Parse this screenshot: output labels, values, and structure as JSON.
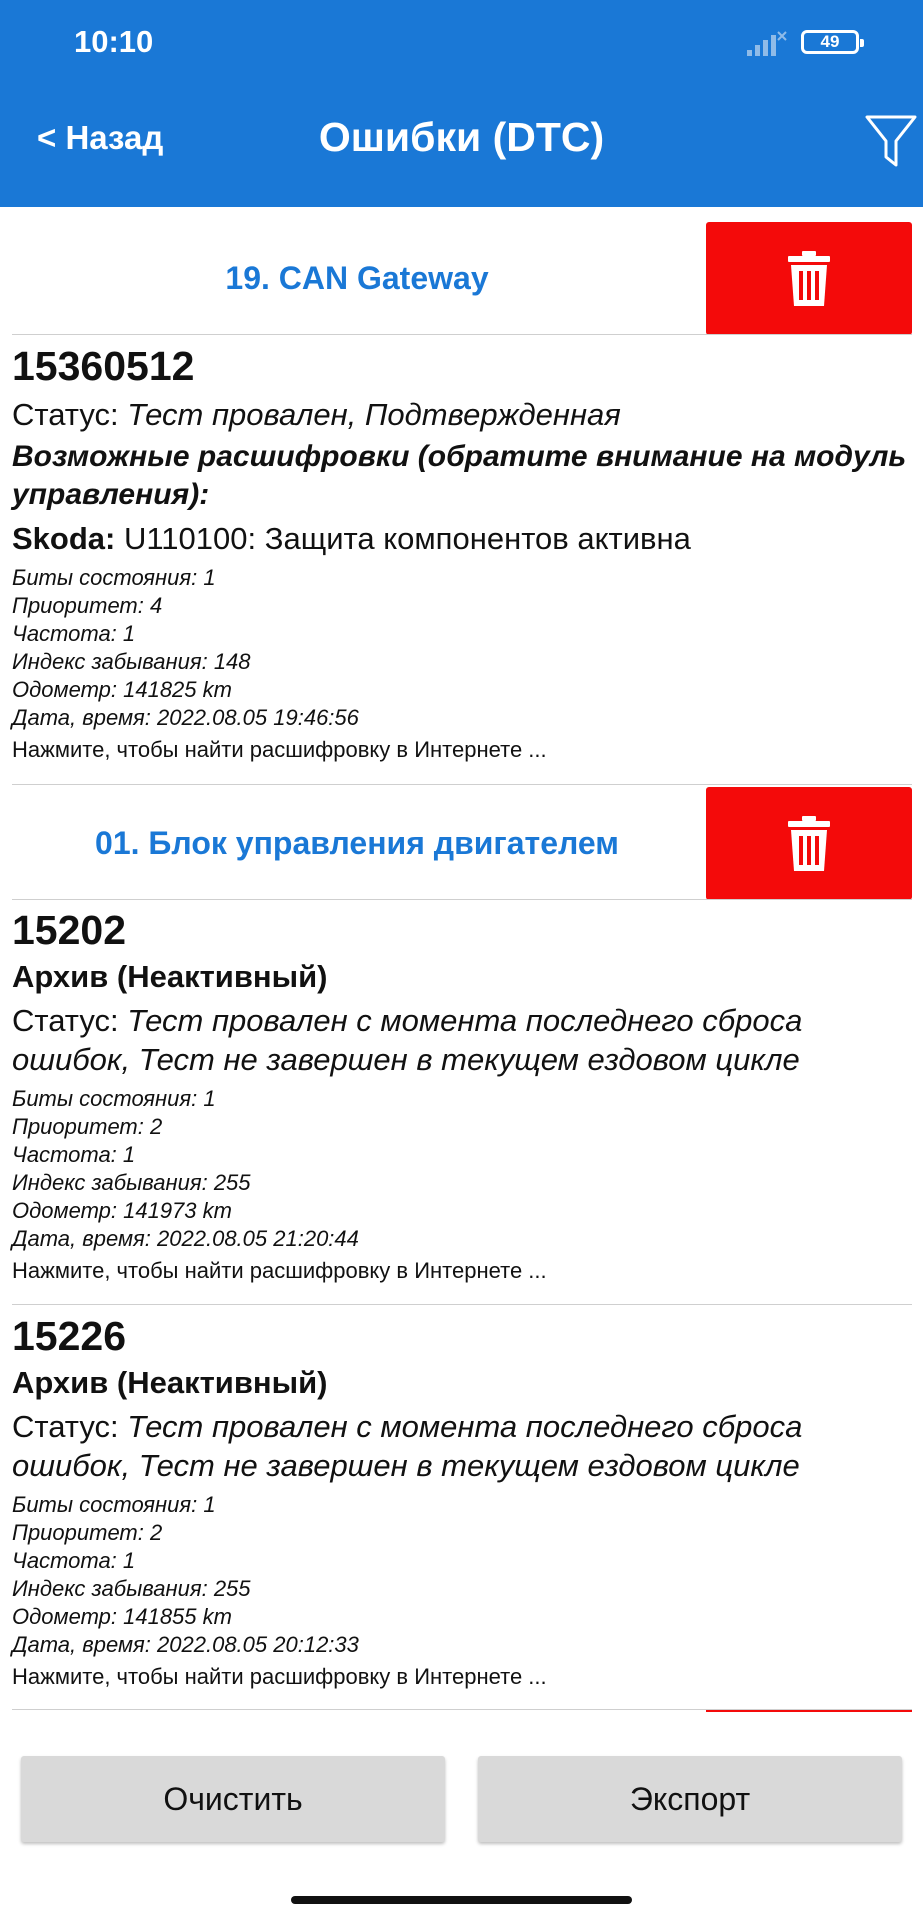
{
  "status_bar": {
    "time": "10:10",
    "battery": "49"
  },
  "header": {
    "back_label": "< Назад",
    "title": "Ошибки (DTC)"
  },
  "colors": {
    "header": "#1a78d6",
    "module_title": "#1a78d6",
    "delete": "#f40a0a",
    "button": "#d9d9d9"
  },
  "modules": [
    {
      "title": "19. CAN Gateway"
    },
    {
      "title": "01. Блок управления двигателем"
    }
  ],
  "dtcs": [
    {
      "code": "15360512",
      "status_label": "Статус: ",
      "status_value": "Тест провален, Подтвержденная",
      "hint": "Возможные расшифровки (обратите внимание на модуль управления):",
      "decode_brand": "Skoda:",
      "decode_text": " U110100: Защита компонентов активна",
      "bits": "Биты состояния: 1",
      "priority": "Приоритет: 4",
      "frequency": "Частота: 1",
      "forget_index": "Индекс забывания: 148",
      "odometer": "Одометр: 141825 km",
      "datetime": "Дата, время: 2022.08.05 19:46:56",
      "search_hint": "Нажмите, чтобы найти расшифровку в Интернете ..."
    },
    {
      "code": "15202",
      "archive": "Архив (Неактивный)",
      "status_label": "Статус: ",
      "status_value": "Тест провален с момента последнего сброса ошибок, Тест не завершен в текущем ездовом цикле",
      "bits": "Биты состояния: 1",
      "priority": "Приоритет: 2",
      "frequency": "Частота: 1",
      "forget_index": "Индекс забывания: 255",
      "odometer": "Одометр: 141973 km",
      "datetime": "Дата, время: 2022.08.05 21:20:44",
      "search_hint": "Нажмите, чтобы найти расшифровку в Интернете ..."
    },
    {
      "code": "15226",
      "archive": "Архив (Неактивный)",
      "status_label": "Статус: ",
      "status_value": "Тест провален с момента последнего сброса ошибок, Тест не завершен в текущем ездовом цикле",
      "bits": "Биты состояния: 1",
      "priority": "Приоритет: 2",
      "frequency": "Частота: 1",
      "forget_index": "Индекс забывания: 255",
      "odometer": "Одометр: 141855 km",
      "datetime": "Дата, время: 2022.08.05 20:12:33",
      "search_hint": "Нажмите, чтобы найти расшифровку в Интернете ..."
    }
  ],
  "actions": {
    "clear_label": "Очистить",
    "export_label": "Экспорт"
  }
}
